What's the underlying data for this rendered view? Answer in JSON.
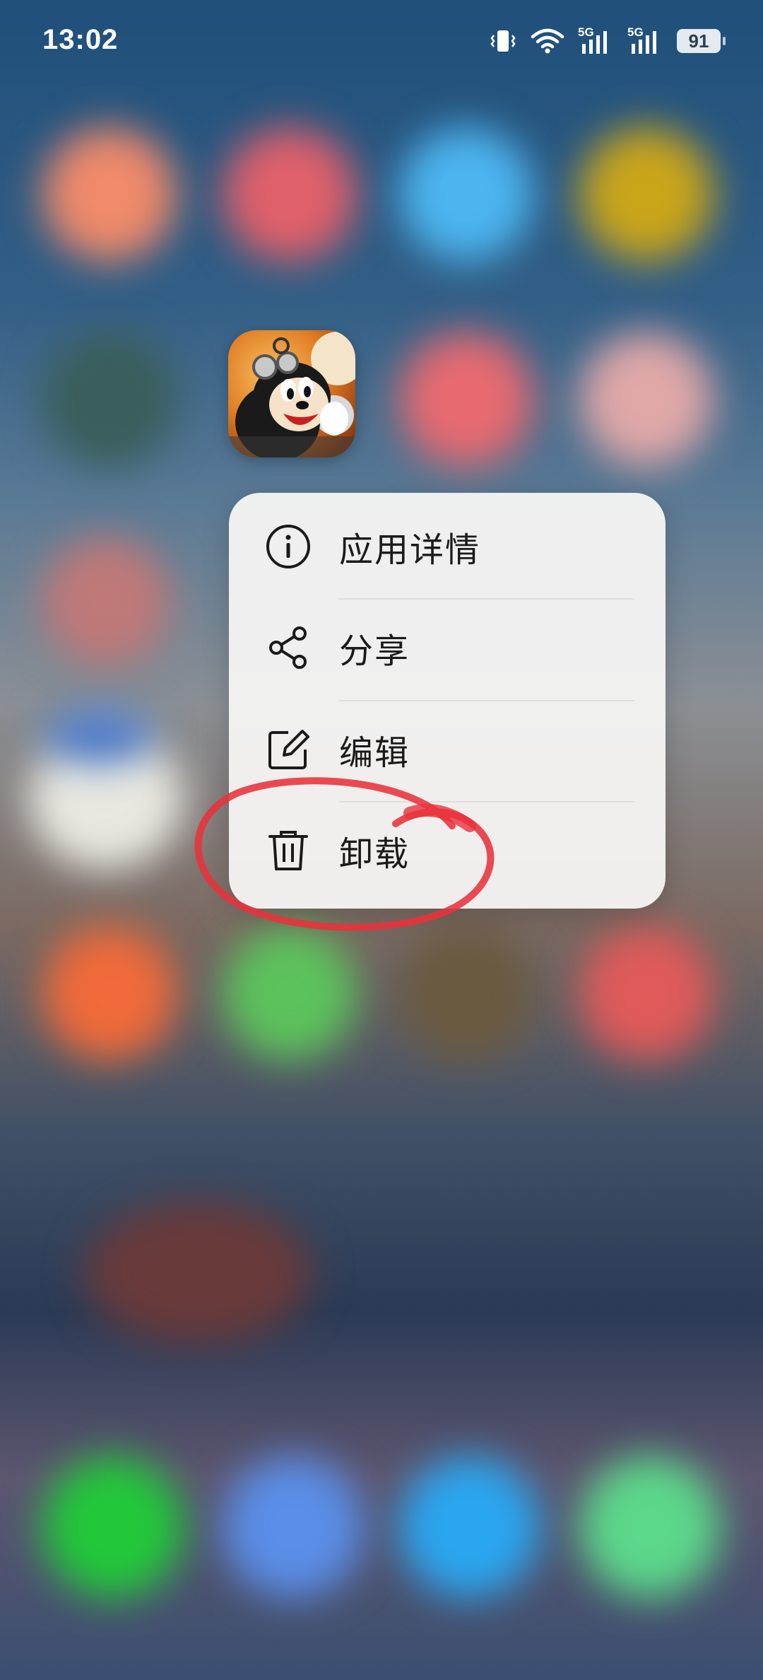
{
  "status_bar": {
    "time": "13:02",
    "battery": "91",
    "signal_1_label": "5G",
    "signal_2_label": "5G",
    "icons": [
      "vibrate-icon",
      "wifi-icon",
      "signal-5g-icon",
      "signal-5g-icon",
      "battery-icon"
    ]
  },
  "focused_app": {
    "icon": "cartoon-game-app-icon"
  },
  "context_menu": {
    "items": [
      {
        "label": "应用详情",
        "icon": "info-icon"
      },
      {
        "label": "分享",
        "icon": "share-icon"
      },
      {
        "label": "编辑",
        "icon": "edit-icon"
      },
      {
        "label": "卸载",
        "icon": "trash-icon"
      }
    ]
  },
  "annotation": {
    "color": "#e8323c",
    "target": "卸载"
  },
  "colors": {
    "menu_background": "#f5f4f3",
    "text": "#1a1a1a"
  }
}
